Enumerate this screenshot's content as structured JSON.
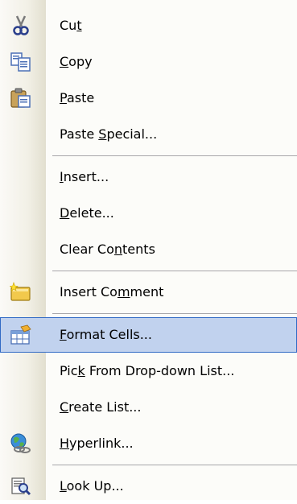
{
  "menu": {
    "items": [
      {
        "pre": "Cu",
        "key": "t",
        "post": "",
        "icon": "scissors-icon"
      },
      {
        "pre": "",
        "key": "C",
        "post": "opy",
        "icon": "copy-icon"
      },
      {
        "pre": "",
        "key": "P",
        "post": "aste",
        "icon": "paste-icon"
      },
      {
        "pre": "Paste ",
        "key": "S",
        "post": "pecial...",
        "icon": ""
      },
      {
        "pre": "",
        "key": "I",
        "post": "nsert...",
        "icon": ""
      },
      {
        "pre": "",
        "key": "D",
        "post": "elete...",
        "icon": ""
      },
      {
        "pre": "Clear Co",
        "key": "n",
        "post": "tents",
        "icon": ""
      },
      {
        "pre": "Insert Co",
        "key": "m",
        "post": "ment",
        "icon": "comment-icon"
      },
      {
        "pre": "",
        "key": "F",
        "post": "ormat Cells...",
        "icon": "format-cells-icon"
      },
      {
        "pre": "Pic",
        "key": "k",
        "post": " From Drop-down List...",
        "icon": ""
      },
      {
        "pre": "",
        "key": "C",
        "post": "reate List...",
        "icon": ""
      },
      {
        "pre": "",
        "key": "H",
        "post": "yperlink...",
        "icon": "hyperlink-icon"
      },
      {
        "pre": "",
        "key": "L",
        "post": "ook Up...",
        "icon": "lookup-icon"
      }
    ]
  }
}
